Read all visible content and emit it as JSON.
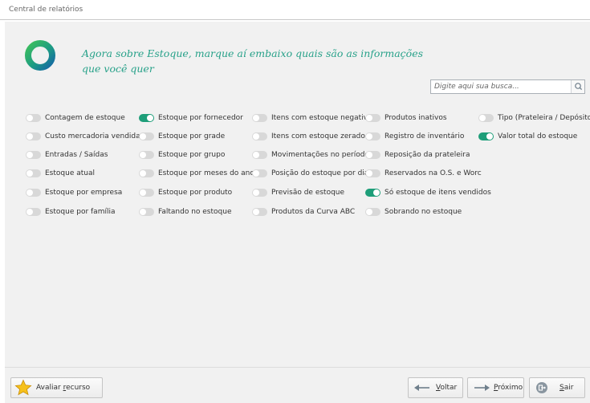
{
  "window": {
    "title": "Central de relatórios"
  },
  "header": {
    "line1": "Agora sobre Estoque, marque aí embaixo quais são as informações",
    "line2": "que você quer"
  },
  "search": {
    "placeholder": "Digite aqui sua busca...",
    "value": ""
  },
  "colors": {
    "accent": "#27a189",
    "toggle_on": "#1e9e79",
    "toggle_off": "#d8d8d8"
  },
  "options": {
    "col1": [
      {
        "label": "Contagem de estoque",
        "checked": false
      },
      {
        "label": "Custo mercadoria vendida",
        "checked": false
      },
      {
        "label": "Entradas / Saídas",
        "checked": false
      },
      {
        "label": "Estoque atual",
        "checked": false
      },
      {
        "label": "Estoque por empresa",
        "checked": false
      },
      {
        "label": "Estoque por família",
        "checked": false
      }
    ],
    "col2": [
      {
        "label": "Estoque por fornecedor",
        "checked": true
      },
      {
        "label": "Estoque por grade",
        "checked": false
      },
      {
        "label": "Estoque por grupo",
        "checked": false
      },
      {
        "label": "Estoque por meses do ano",
        "checked": false
      },
      {
        "label": "Estoque por produto",
        "checked": false
      },
      {
        "label": "Faltando no estoque",
        "checked": false
      }
    ],
    "col3": [
      {
        "label": "Itens com estoque negativo",
        "checked": false
      },
      {
        "label": "Itens com estoque zerado",
        "checked": false
      },
      {
        "label": "Movimentações no período",
        "checked": false
      },
      {
        "label": "Posição do estoque por dia",
        "checked": false
      },
      {
        "label": "Previsão de estoque",
        "checked": false
      },
      {
        "label": "Produtos da Curva ABC",
        "checked": false
      }
    ],
    "col4": [
      {
        "label": "Produtos inativos",
        "checked": false
      },
      {
        "label": "Registro de inventário",
        "checked": false
      },
      {
        "label": "Reposição da prateleira",
        "checked": false
      },
      {
        "label": "Reservados na O.S. e Worc",
        "checked": false
      },
      {
        "label": "Só estoque de itens vendidos",
        "checked": true
      },
      {
        "label": "Sobrando no estoque",
        "checked": false
      }
    ],
    "col5": [
      {
        "label": "Tipo (Prateleira / Depósito)",
        "checked": false
      },
      {
        "label": "Valor total do estoque",
        "checked": true
      }
    ]
  },
  "footer": {
    "rate_a": "Avaliar ",
    "rate_b": "r",
    "rate_c": "ecurso",
    "back_a": "V",
    "back_b": "oltar",
    "next_a": "P",
    "next_b": "róximo",
    "exit_a": "S",
    "exit_b": "air"
  }
}
